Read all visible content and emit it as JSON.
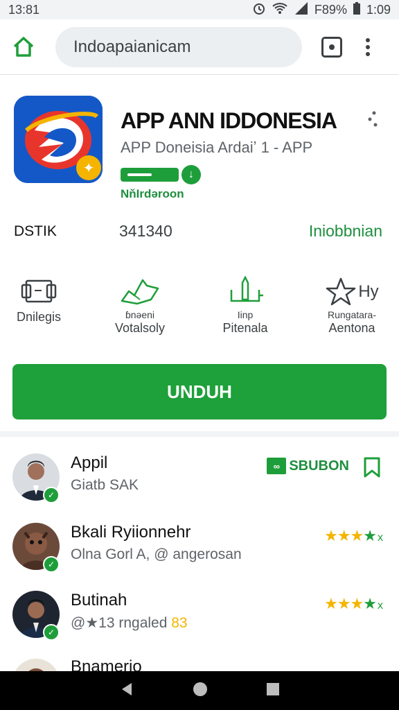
{
  "status_bar": {
    "time_left": "13:81",
    "battery": "F89%",
    "time_right": "1:09"
  },
  "browser": {
    "url": "Indoapaianicam"
  },
  "app": {
    "title": "APP ANN IDDONESIA",
    "subtitle": "APP Doneisia Ardaiʼ 1 - APP",
    "developer": "NňIrdəroon",
    "progress": 0.55,
    "meta_label": "DSTIK",
    "meta_value": "341340",
    "meta_link": "Iniobbnian",
    "download_label": "UNDUH"
  },
  "features": [
    {
      "icon": "devices-icon",
      "line1": "",
      "line2": "Dnilegis"
    },
    {
      "icon": "hand-icon",
      "line1": "ɓnəeni",
      "line2": "Votalsoly"
    },
    {
      "icon": "monument-icon",
      "line1": "Iinp",
      "line2": "Pitenala"
    },
    {
      "icon": "star-outline-icon",
      "line1": "Rungatara-",
      "line2": "Aentona",
      "extra": "Hy"
    }
  ],
  "reviews": [
    {
      "name": "Appil",
      "sub": "Giatb SAK",
      "badge_box": "∞",
      "badge_text": "SBUBON"
    },
    {
      "name": "Bkali Ryiionnehr",
      "sub": "Olna Gorl A, @ angerosan",
      "stars": "★★★"
    },
    {
      "name": "Butinah",
      "sub": "@★13 rngaled",
      "sub_extra": "83",
      "stars": "★★★"
    },
    {
      "name": "Bnamerio"
    }
  ],
  "colors": {
    "accent_green": "#1ea03a",
    "star_yellow": "#f4b400",
    "app_blue": "#1458c7"
  }
}
